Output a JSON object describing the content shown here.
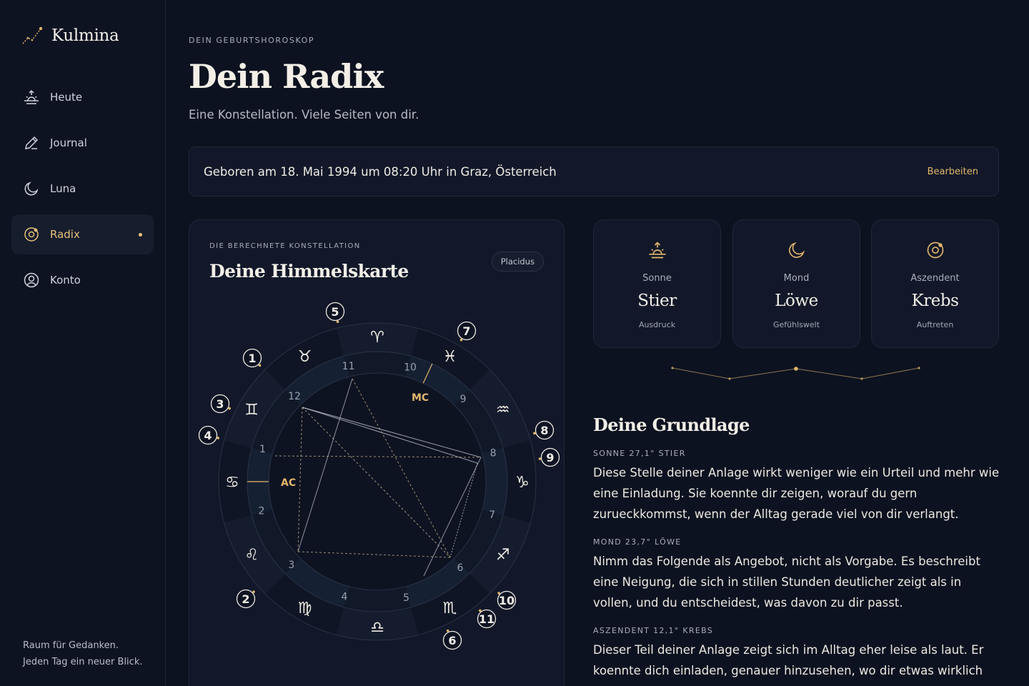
{
  "brand": {
    "name": "Kulmina"
  },
  "sidebar": {
    "items": [
      {
        "label": "Heute",
        "icon": "sunrise-icon",
        "active": false
      },
      {
        "label": "Journal",
        "icon": "pen-icon",
        "active": false
      },
      {
        "label": "Luna",
        "icon": "moon-icon",
        "active": false
      },
      {
        "label": "Radix",
        "icon": "radix-icon",
        "active": true
      },
      {
        "label": "Konto",
        "icon": "user-circle-icon",
        "active": false
      }
    ],
    "footer_line1": "Raum für Gedanken.",
    "footer_line2": "Jeden Tag ein neuer Blick."
  },
  "header": {
    "eyebrow": "DEIN GEBURTSHOROSKOP",
    "title": "Dein Radix",
    "subtitle": "Eine Konstellation. Viele Seiten von dir."
  },
  "birth": {
    "text": "Geboren am 18. Mai 1994 um 08:20 Uhr in Graz, Österreich",
    "edit_label": "Bearbeiten"
  },
  "chart": {
    "eyebrow": "DIE BERECHNETE KONSTELLATION",
    "title": "Deine Himmelskarte",
    "house_system": "Placidus",
    "ac_label": "AC",
    "mc_label": "MC",
    "houses": [
      "1",
      "2",
      "3",
      "4",
      "5",
      "6",
      "7",
      "8",
      "9",
      "10",
      "11",
      "12"
    ],
    "signs": [
      "♋",
      "♌",
      "♍",
      "♎",
      "♏",
      "♐",
      "♑",
      "♒",
      "♓",
      "♈",
      "♉",
      "♊"
    ],
    "planet_markers": [
      "1",
      "2",
      "3",
      "4",
      "5",
      "6",
      "7",
      "8",
      "9",
      "10",
      "11"
    ]
  },
  "big_three": [
    {
      "label": "Sonne",
      "sign": "Stier",
      "desc": "Ausdruck",
      "icon": "sunrise-icon"
    },
    {
      "label": "Mond",
      "sign": "Löwe",
      "desc": "Gefühlswelt",
      "icon": "moon-icon"
    },
    {
      "label": "Aszendent",
      "sign": "Krebs",
      "desc": "Auftreten",
      "icon": "radix-icon"
    }
  ],
  "foundation": {
    "title": "Deine Grundlage",
    "entries": [
      {
        "label": "SONNE 27,1° STIER",
        "text": "Diese Stelle deiner Anlage wirkt weniger wie ein Urteil und mehr wie eine Einladung. Sie koennte dir zeigen, worauf du gern zurueckkommst, wenn der Alltag gerade viel von dir verlangt."
      },
      {
        "label": "MOND 23,7° LÖWE",
        "text": "Nimm das Folgende als Angebot, nicht als Vorgabe. Es beschreibt eine Neigung, die sich in stillen Stunden deutlicher zeigt als in vollen, und du entscheidest, was davon zu dir passt."
      },
      {
        "label": "ASZENDENT 12,1° KREBS",
        "text": "Dieser Teil deiner Anlage zeigt sich im Alltag eher leise als laut. Er koennte dich einladen, genauer hinzusehen, wo dir etwas wirklich"
      }
    ]
  },
  "colors": {
    "accent": "#e2b66c",
    "background": "#0d1220",
    "card": "#121829"
  }
}
